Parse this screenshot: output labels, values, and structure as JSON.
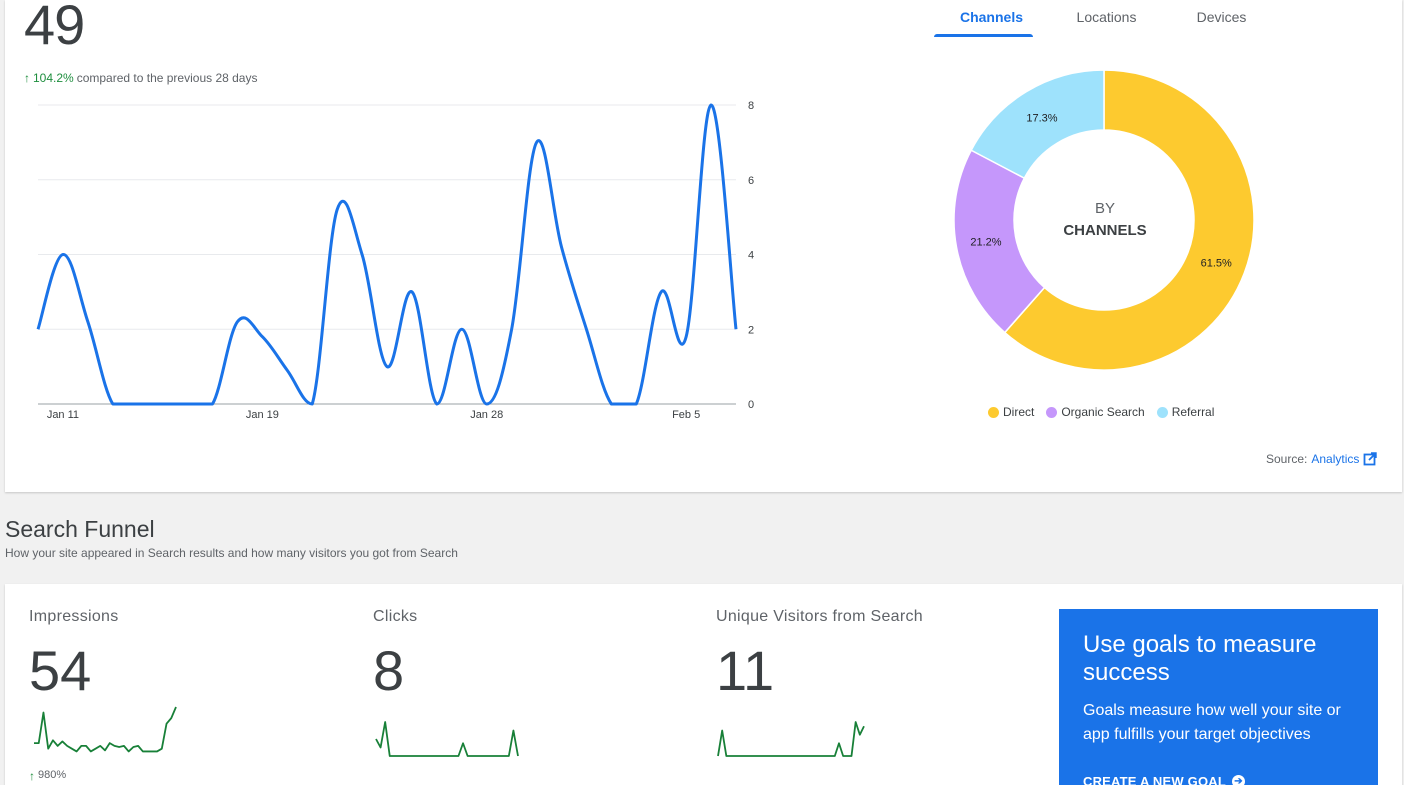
{
  "overview": {
    "total": "49",
    "change_pct": "104.2%",
    "change_text": "compared to the previous 28 days"
  },
  "tabs": [
    "Channels",
    "Locations",
    "Devices"
  ],
  "donut_center": {
    "line1": "BY",
    "line2": "CHANNELS"
  },
  "legend": [
    {
      "label": "Direct",
      "color": "#fdca2f"
    },
    {
      "label": "Organic Search",
      "color": "#c597fb"
    },
    {
      "label": "Referral",
      "color": "#9ee2fc"
    }
  ],
  "source": {
    "prefix": "Source:",
    "link": "Analytics"
  },
  "funnel": {
    "title": "Search Funnel",
    "subtitle": "How your site appeared in Search results and how many visitors you got from Search",
    "metrics": [
      {
        "label": "Impressions",
        "value": "54",
        "delta": "980%"
      },
      {
        "label": "Clicks",
        "value": "8",
        "delta": ""
      },
      {
        "label": "Unique Visitors from Search",
        "value": "11",
        "delta": ""
      }
    ],
    "sparklines": [
      [
        2.5,
        2.5,
        8,
        1.5,
        3,
        2,
        2.8,
        2,
        1.5,
        1,
        2,
        2,
        1,
        1.5,
        2,
        1.2,
        2.5,
        2,
        1.8,
        2,
        1,
        1.8,
        2,
        1,
        1,
        1,
        1,
        1.5,
        6,
        7,
        9
      ],
      [
        2,
        1,
        4,
        0,
        0,
        0,
        0,
        0,
        0,
        0,
        0,
        0,
        0,
        0,
        0,
        0,
        0,
        0,
        0,
        1.5,
        0,
        0,
        0,
        0,
        0,
        0,
        0,
        0,
        0,
        0,
        3,
        0
      ],
      [
        0,
        3,
        0,
        0,
        0,
        0,
        0,
        0,
        0,
        0,
        0,
        0,
        0,
        0,
        0,
        0,
        0,
        0,
        0,
        0,
        0,
        0,
        0,
        0,
        0,
        0,
        0,
        0,
        0,
        1.5,
        0,
        0,
        0,
        4,
        2.5,
        3.5
      ]
    ]
  },
  "goal_card": {
    "title": "Use goals to measure success",
    "desc": "Goals measure how well your site or app fulfills your target objectives",
    "cta": "CREATE A NEW GOAL"
  },
  "chart_data": [
    {
      "type": "line",
      "x_tick_labels": [
        "Jan 11",
        "Jan 19",
        "Jan 28",
        "Feb 5"
      ],
      "x_tick_index": [
        1,
        9,
        18,
        26
      ],
      "y_ticks": [
        0,
        2,
        4,
        6,
        8
      ],
      "ylim": [
        0,
        8
      ],
      "color": "#1a73e8",
      "values": [
        2,
        4,
        2.2,
        0,
        0,
        0,
        0,
        0,
        2.2,
        1.8,
        0.9,
        0,
        5.2,
        4,
        1,
        3,
        0,
        2,
        0,
        2,
        7,
        4.2,
        2,
        0,
        0,
        3,
        1.8,
        8,
        2
      ]
    },
    {
      "type": "pie",
      "donut": true,
      "slices": [
        {
          "label": "Direct",
          "value": 61.5,
          "display": "61.5%",
          "color": "#fdca2f"
        },
        {
          "label": "Organic Search",
          "value": 21.2,
          "display": "21.2%",
          "color": "#c597fb"
        },
        {
          "label": "Referral",
          "value": 17.3,
          "display": "17.3%",
          "color": "#9ee2fc"
        }
      ]
    }
  ]
}
